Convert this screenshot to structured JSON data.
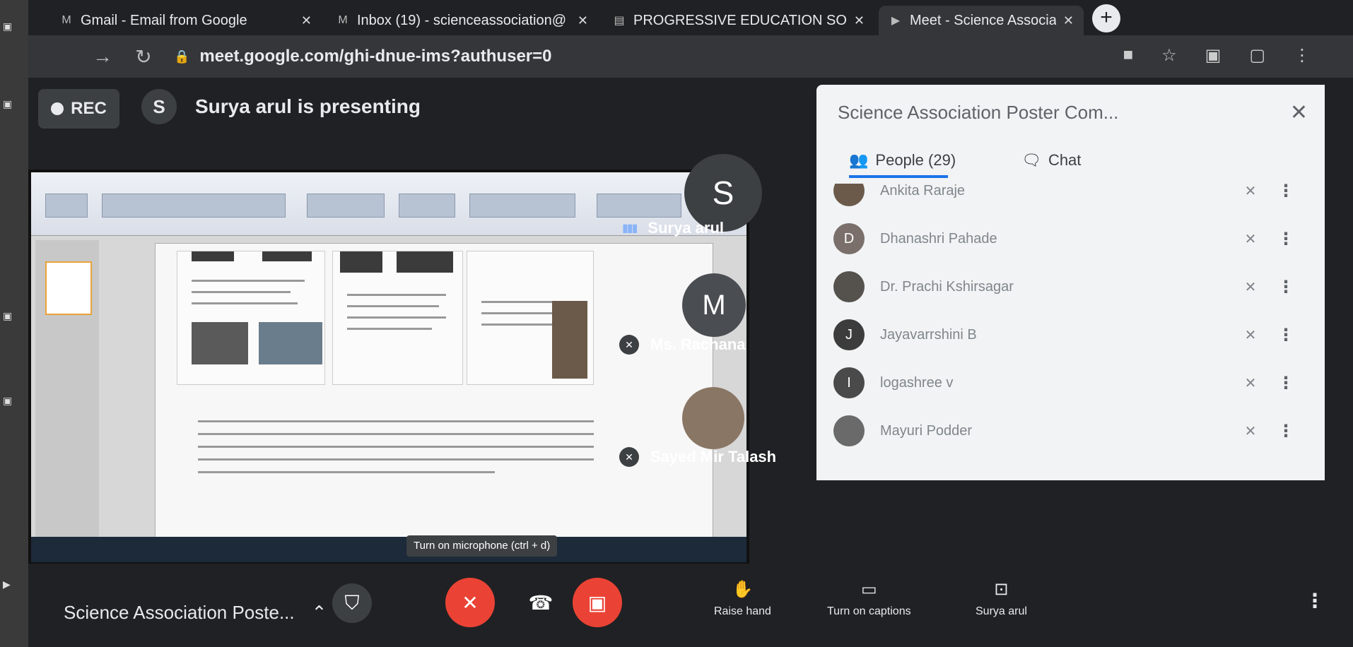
{
  "browser": {
    "tabs": [
      {
        "title": "Gmail - Email from Google",
        "favicon": "gmail-icon",
        "active": false
      },
      {
        "title": "Inbox (19) - scienceassociation@",
        "favicon": "gmail-icon",
        "active": false
      },
      {
        "title": "PROGRESSIVE EDUCATION SOC",
        "favicon": "document-icon",
        "active": false
      },
      {
        "title": "Meet - Science Association",
        "favicon": "meet-icon",
        "active": true
      }
    ],
    "url": "meet.google.com/ghi-dnue-ims?authuser=0"
  },
  "meet": {
    "rec_label": "REC",
    "presenter_initial": "S",
    "presenting_text": "Surya arul is presenting",
    "participants": [
      {
        "initial": "S",
        "name": "Surya arul",
        "status": "speaking"
      },
      {
        "initial": "M",
        "name": "Ms. Rachana",
        "status": "muted"
      },
      {
        "initial": "",
        "name": "Sayed Mir Talash",
        "status": "muted"
      }
    ]
  },
  "side_panel": {
    "title": "Science Association Poster Com...",
    "tab_people": "People (29)",
    "tab_chat": "Chat",
    "people": [
      {
        "initial": "",
        "name": "Ankita Raraje",
        "color": "#6b5a4a"
      },
      {
        "initial": "D",
        "name": "Dhanashri Pahade",
        "color": "#7b6f6b"
      },
      {
        "initial": "",
        "name": "Dr. Prachi Kshirsagar",
        "color": "#55524e"
      },
      {
        "initial": "J",
        "name": "Jayavarrshini B",
        "color": "#3c3c3c"
      },
      {
        "initial": "I",
        "name": "logashree v",
        "color": "#4a4a4a"
      },
      {
        "initial": "",
        "name": "Mayuri Podder",
        "color": "#6a6a6a"
      }
    ]
  },
  "controls": {
    "tooltip": "Turn on microphone (ctrl + d)",
    "meeting_name": "Science Association Poste...",
    "raise_hand": "Raise hand",
    "captions": "Turn on captions",
    "present_now": "Surya arul"
  }
}
